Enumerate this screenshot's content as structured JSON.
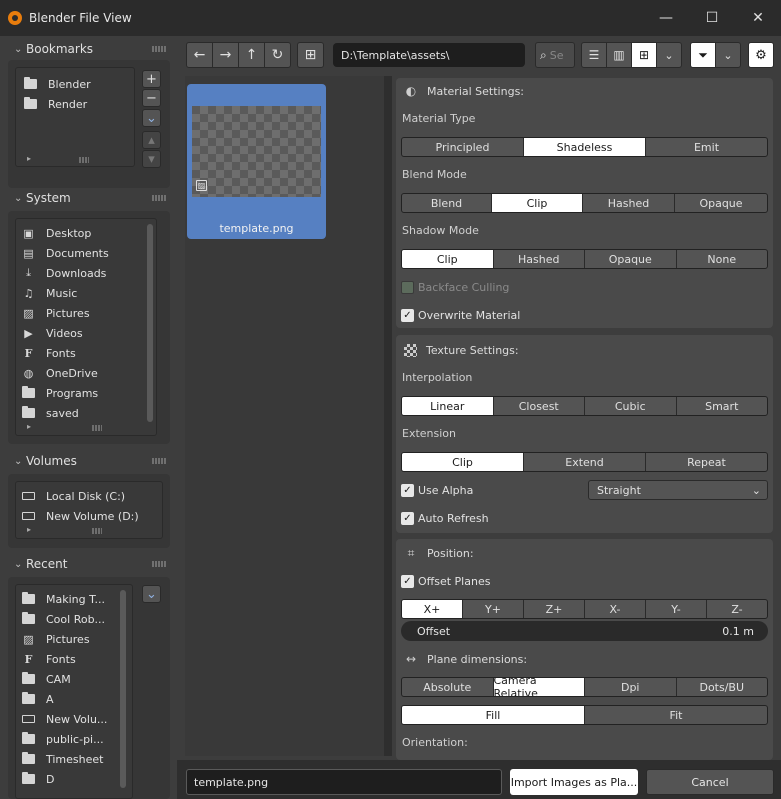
{
  "window": {
    "title": "Blender File View",
    "buttons": {
      "minimize": "—",
      "maximize": "☐",
      "close": "✕"
    }
  },
  "sidebar": {
    "bookmarks": {
      "title": "Bookmarks",
      "items": [
        {
          "label": "Blender",
          "icon": "folder-icon"
        },
        {
          "label": "Render",
          "icon": "folder-icon"
        }
      ]
    },
    "system": {
      "title": "System",
      "items": [
        {
          "label": "Desktop",
          "icon": "desktop-icon"
        },
        {
          "label": "Documents",
          "icon": "documents-icon"
        },
        {
          "label": "Downloads",
          "icon": "download-icon"
        },
        {
          "label": "Music",
          "icon": "music-icon"
        },
        {
          "label": "Pictures",
          "icon": "pictures-icon"
        },
        {
          "label": "Videos",
          "icon": "videos-icon"
        },
        {
          "label": "Fonts",
          "icon": "font-icon"
        },
        {
          "label": "OneDrive",
          "icon": "globe-icon"
        },
        {
          "label": "Programs",
          "icon": "folder-icon"
        },
        {
          "label": "saved",
          "icon": "folder-icon"
        }
      ]
    },
    "volumes": {
      "title": "Volumes",
      "items": [
        {
          "label": "Local Disk (C:)",
          "icon": "disk-icon"
        },
        {
          "label": "New Volume (D:)",
          "icon": "disk-icon"
        }
      ]
    },
    "recent": {
      "title": "Recent",
      "items": [
        {
          "label": "Making T...",
          "icon": "folder-icon"
        },
        {
          "label": "Cool Rob...",
          "icon": "folder-icon"
        },
        {
          "label": "Pictures",
          "icon": "pictures-icon"
        },
        {
          "label": "Fonts",
          "icon": "font-icon"
        },
        {
          "label": "CAM",
          "icon": "folder-icon"
        },
        {
          "label": "A",
          "icon": "folder-icon"
        },
        {
          "label": "New Volu...",
          "icon": "disk-icon"
        },
        {
          "label": "public-pi...",
          "icon": "folder-icon"
        },
        {
          "label": "Timesheet",
          "icon": "folder-icon"
        },
        {
          "label": "D",
          "icon": "folder-icon"
        }
      ]
    }
  },
  "toolbar": {
    "path": "D:\\Template\\assets\\",
    "search_placeholder": "Se"
  },
  "files": [
    {
      "name": "template.png"
    }
  ],
  "material": {
    "title": "Material Settings:",
    "type_label": "Material Type",
    "types": [
      "Principled",
      "Shadeless",
      "Emit"
    ],
    "type_selected": "Shadeless",
    "blend_label": "Blend Mode",
    "blend": [
      "Blend",
      "Clip",
      "Hashed",
      "Opaque"
    ],
    "blend_selected": "Clip",
    "shadow_label": "Shadow Mode",
    "shadow": [
      "Clip",
      "Hashed",
      "Opaque",
      "None"
    ],
    "shadow_selected": "Clip",
    "backface_label": "Backface Culling",
    "backface_checked": false,
    "overwrite_label": "Overwrite Material",
    "overwrite_checked": true
  },
  "texture": {
    "title": "Texture Settings:",
    "interp_label": "Interpolation",
    "interp": [
      "Linear",
      "Closest",
      "Cubic",
      "Smart"
    ],
    "interp_selected": "Linear",
    "ext_label": "Extension",
    "ext": [
      "Clip",
      "Extend",
      "Repeat"
    ],
    "ext_selected": "Clip",
    "alpha_label": "Use Alpha",
    "alpha_checked": true,
    "alpha_mode": "Straight",
    "refresh_label": "Auto Refresh",
    "refresh_checked": true
  },
  "position": {
    "title": "Position:",
    "offset_planes_label": "Offset Planes",
    "offset_planes_checked": true,
    "axes": [
      "X+",
      "Y+",
      "Z+",
      "X-",
      "Y-",
      "Z-"
    ],
    "axis_selected": "X+",
    "offset_label": "Offset",
    "offset_value": "0.1 m",
    "dims_title": "Plane dimensions:",
    "dims": [
      "Absolute",
      "Camera Relative",
      "Dpi",
      "Dots/BU"
    ],
    "dims_selected": "Camera Relative",
    "fit": [
      "Fill",
      "Fit"
    ],
    "fit_selected": "Fill",
    "orientation_label": "Orientation:"
  },
  "footer": {
    "filename": "template.png",
    "import_label": "Import Images as Pla...",
    "cancel_label": "Cancel"
  },
  "colors": {
    "accent": "#5680c2",
    "selected_segment": "#ffffff",
    "window_bg": "#3d3d3d",
    "titlebar": "#2b2b2b"
  }
}
